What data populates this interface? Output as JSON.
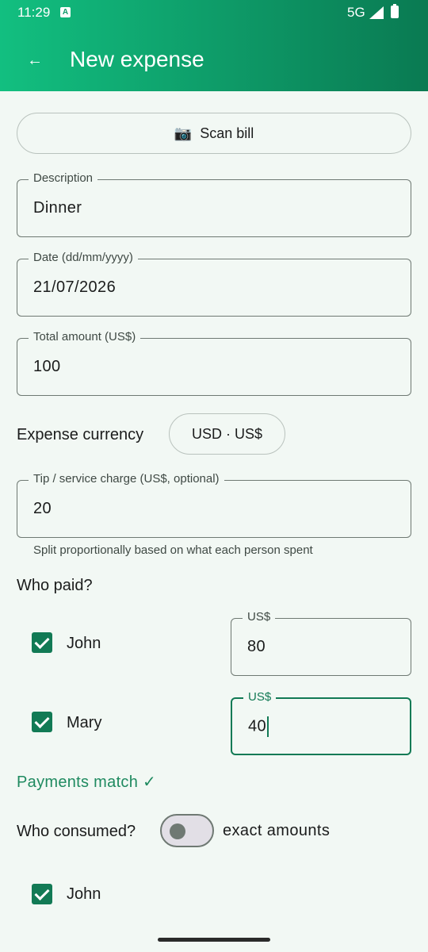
{
  "status": {
    "time": "11:29",
    "notif_icon_letter": "A",
    "network": "5G",
    "icons": [
      "signal-icon",
      "battery-icon"
    ]
  },
  "appbar": {
    "title": "New expense",
    "back_icon": "←"
  },
  "scan": {
    "icon": "📷",
    "label": "Scan bill"
  },
  "description": {
    "label": "Description",
    "value": "Dinner"
  },
  "date": {
    "label": "Date (dd/mm/yyyy)",
    "value": "21/07/2026"
  },
  "total": {
    "label": "Total amount (US$)",
    "value": "100"
  },
  "currency": {
    "label": "Expense currency",
    "button": "USD · US$"
  },
  "tip": {
    "label": "Tip / service charge (US$, optional)",
    "value": "20",
    "helper": "Split proportionally based on what each person spent"
  },
  "who_paid": {
    "label": "Who paid?",
    "people": [
      {
        "name": "John",
        "checked": true,
        "amount_label": "US$",
        "amount": "80"
      },
      {
        "name": "Mary",
        "checked": true,
        "amount_label": "US$",
        "amount": "40"
      }
    ]
  },
  "payments_match": "Payments match ✓",
  "who_consumed": {
    "label": "Who consumed?",
    "toggle_label": "exact amounts",
    "toggle_on": false,
    "people": [
      {
        "name": "John",
        "checked": true
      }
    ]
  },
  "colors": {
    "accent": "#127a55",
    "appbar_start": "#12bf80",
    "appbar_end": "#0a7a52",
    "background": "#f2f8f4"
  }
}
